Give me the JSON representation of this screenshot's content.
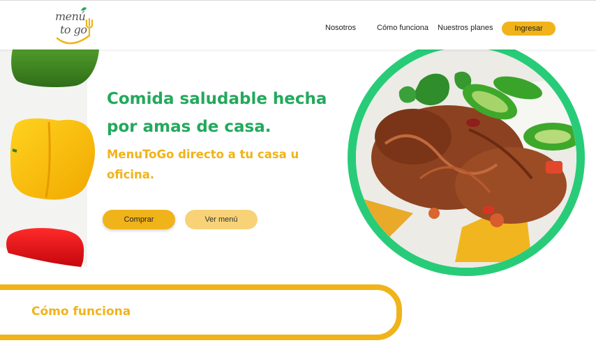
{
  "brand": {
    "logo_line1": "menú",
    "logo_line2": "to go"
  },
  "nav": {
    "items": [
      {
        "label": "Nosotros"
      },
      {
        "label": "Cómo funciona"
      },
      {
        "label": "Nuestros planes"
      }
    ],
    "login_label": "Ingresar"
  },
  "hero": {
    "title": "Comida saludable hecha por amas de casa.",
    "subtitle": "MenuToGo directo a tu casa u oficina.",
    "buy_label": "Comprar",
    "menu_label": "Ver menú"
  },
  "how": {
    "title": "Cómo funciona"
  },
  "colors": {
    "brand_green": "#23a95c",
    "ring_green": "#28cc78",
    "brand_yellow": "#f0b319",
    "light_yellow": "#f7d277"
  }
}
